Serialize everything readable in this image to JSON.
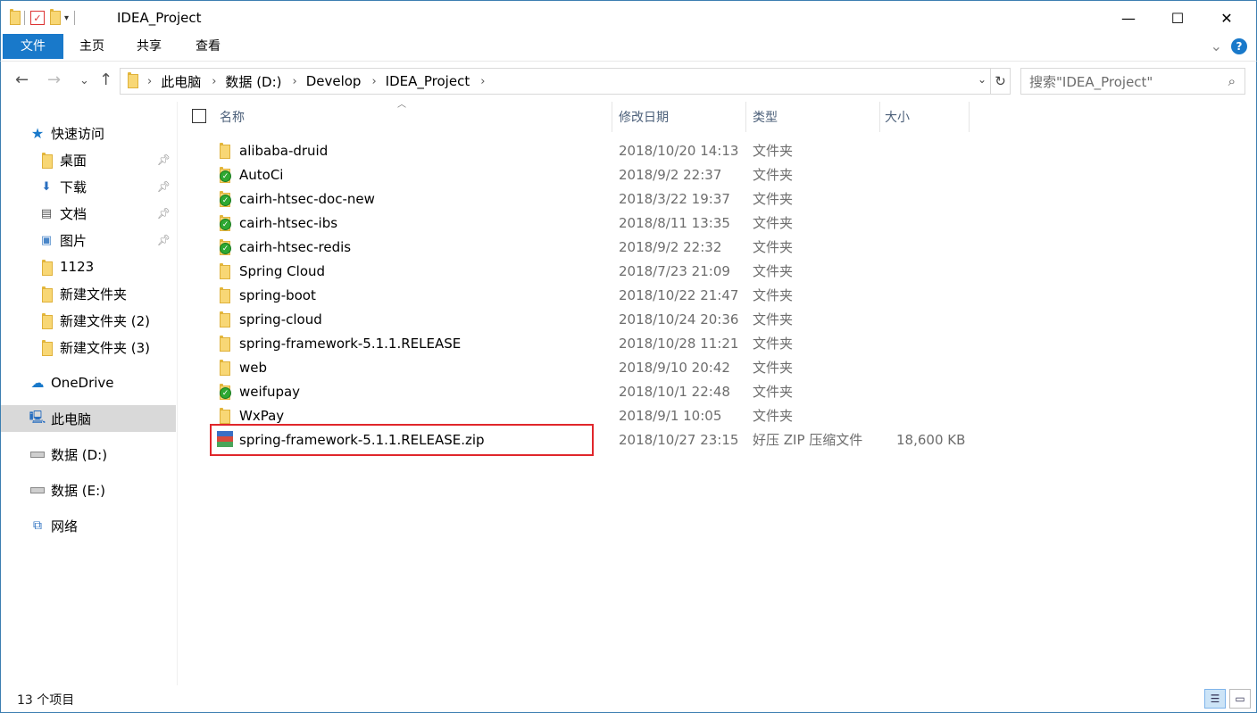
{
  "window": {
    "title": "IDEA_Project",
    "minimize_glyph": "—",
    "maximize_glyph": "☐",
    "close_glyph": "✕"
  },
  "ribbon": {
    "tabs": [
      "文件",
      "主页",
      "共享",
      "查看"
    ],
    "help_glyph": "?",
    "collapse_glyph": "⌄"
  },
  "nav": {
    "back_glyph": "←",
    "forward_glyph": "→",
    "recent_glyph": "⌄",
    "up_glyph": "↑",
    "breadcrumb": [
      "此电脑",
      "数据 (D:)",
      "Develop",
      "IDEA_Project"
    ],
    "refresh_glyph": "↻",
    "search_placeholder": "搜索\"IDEA_Project\""
  },
  "sidebar": {
    "items": [
      {
        "label": "快速访问",
        "icon": "star-icon"
      },
      {
        "label": "桌面",
        "icon": "folder-icon",
        "pinned": true
      },
      {
        "label": "下载",
        "icon": "download-folder-icon",
        "pinned": true
      },
      {
        "label": "文档",
        "icon": "document-icon",
        "pinned": true
      },
      {
        "label": "图片",
        "icon": "picture-icon",
        "pinned": true
      },
      {
        "label": "1123",
        "icon": "folder-icon"
      },
      {
        "label": "新建文件夹",
        "icon": "folder-icon"
      },
      {
        "label": "新建文件夹 (2)",
        "icon": "folder-icon"
      },
      {
        "label": "新建文件夹 (3)",
        "icon": "folder-icon"
      },
      {
        "label": "OneDrive",
        "icon": "cloud-icon"
      },
      {
        "label": "此电脑",
        "icon": "computer-icon",
        "selected": true
      },
      {
        "label": "数据 (D:)",
        "icon": "drive-icon"
      },
      {
        "label": "数据 (E:)",
        "icon": "drive-icon"
      },
      {
        "label": "网络",
        "icon": "network-icon"
      }
    ]
  },
  "columns": {
    "name": "名称",
    "date": "修改日期",
    "type": "类型",
    "size": "大小"
  },
  "files": [
    {
      "name": "alibaba-druid",
      "date": "2018/10/20 14:13",
      "type": "文件夹",
      "size": "",
      "icon": "folder-icon"
    },
    {
      "name": "AutoCi",
      "date": "2018/9/2 22:37",
      "type": "文件夹",
      "size": "",
      "icon": "folder-synced-icon"
    },
    {
      "name": "cairh-htsec-doc-new",
      "date": "2018/3/22 19:37",
      "type": "文件夹",
      "size": "",
      "icon": "folder-synced-icon"
    },
    {
      "name": "cairh-htsec-ibs",
      "date": "2018/8/11 13:35",
      "type": "文件夹",
      "size": "",
      "icon": "folder-synced-icon"
    },
    {
      "name": "cairh-htsec-redis",
      "date": "2018/9/2 22:32",
      "type": "文件夹",
      "size": "",
      "icon": "folder-synced-icon"
    },
    {
      "name": "Spring Cloud",
      "date": "2018/7/23 21:09",
      "type": "文件夹",
      "size": "",
      "icon": "folder-icon"
    },
    {
      "name": "spring-boot",
      "date": "2018/10/22 21:47",
      "type": "文件夹",
      "size": "",
      "icon": "folder-icon"
    },
    {
      "name": "spring-cloud",
      "date": "2018/10/24 20:36",
      "type": "文件夹",
      "size": "",
      "icon": "folder-icon"
    },
    {
      "name": "spring-framework-5.1.1.RELEASE",
      "date": "2018/10/28 11:21",
      "type": "文件夹",
      "size": "",
      "icon": "folder-icon"
    },
    {
      "name": "web",
      "date": "2018/9/10 20:42",
      "type": "文件夹",
      "size": "",
      "icon": "folder-icon"
    },
    {
      "name": "weifupay",
      "date": "2018/10/1 22:48",
      "type": "文件夹",
      "size": "",
      "icon": "folder-synced-icon"
    },
    {
      "name": "WxPay",
      "date": "2018/9/1 10:05",
      "type": "文件夹",
      "size": "",
      "icon": "folder-icon"
    },
    {
      "name": "spring-framework-5.1.1.RELEASE.zip",
      "date": "2018/10/27 23:15",
      "type": "好压 ZIP 压缩文件",
      "size": "18,600 KB",
      "icon": "zip-archive-icon",
      "highlighted": true
    }
  ],
  "status": {
    "item_count": "13 个项目"
  },
  "colors": {
    "accent": "#1979ca",
    "highlight_border": "#e0262b",
    "selected_bg": "#d9d9d9"
  }
}
